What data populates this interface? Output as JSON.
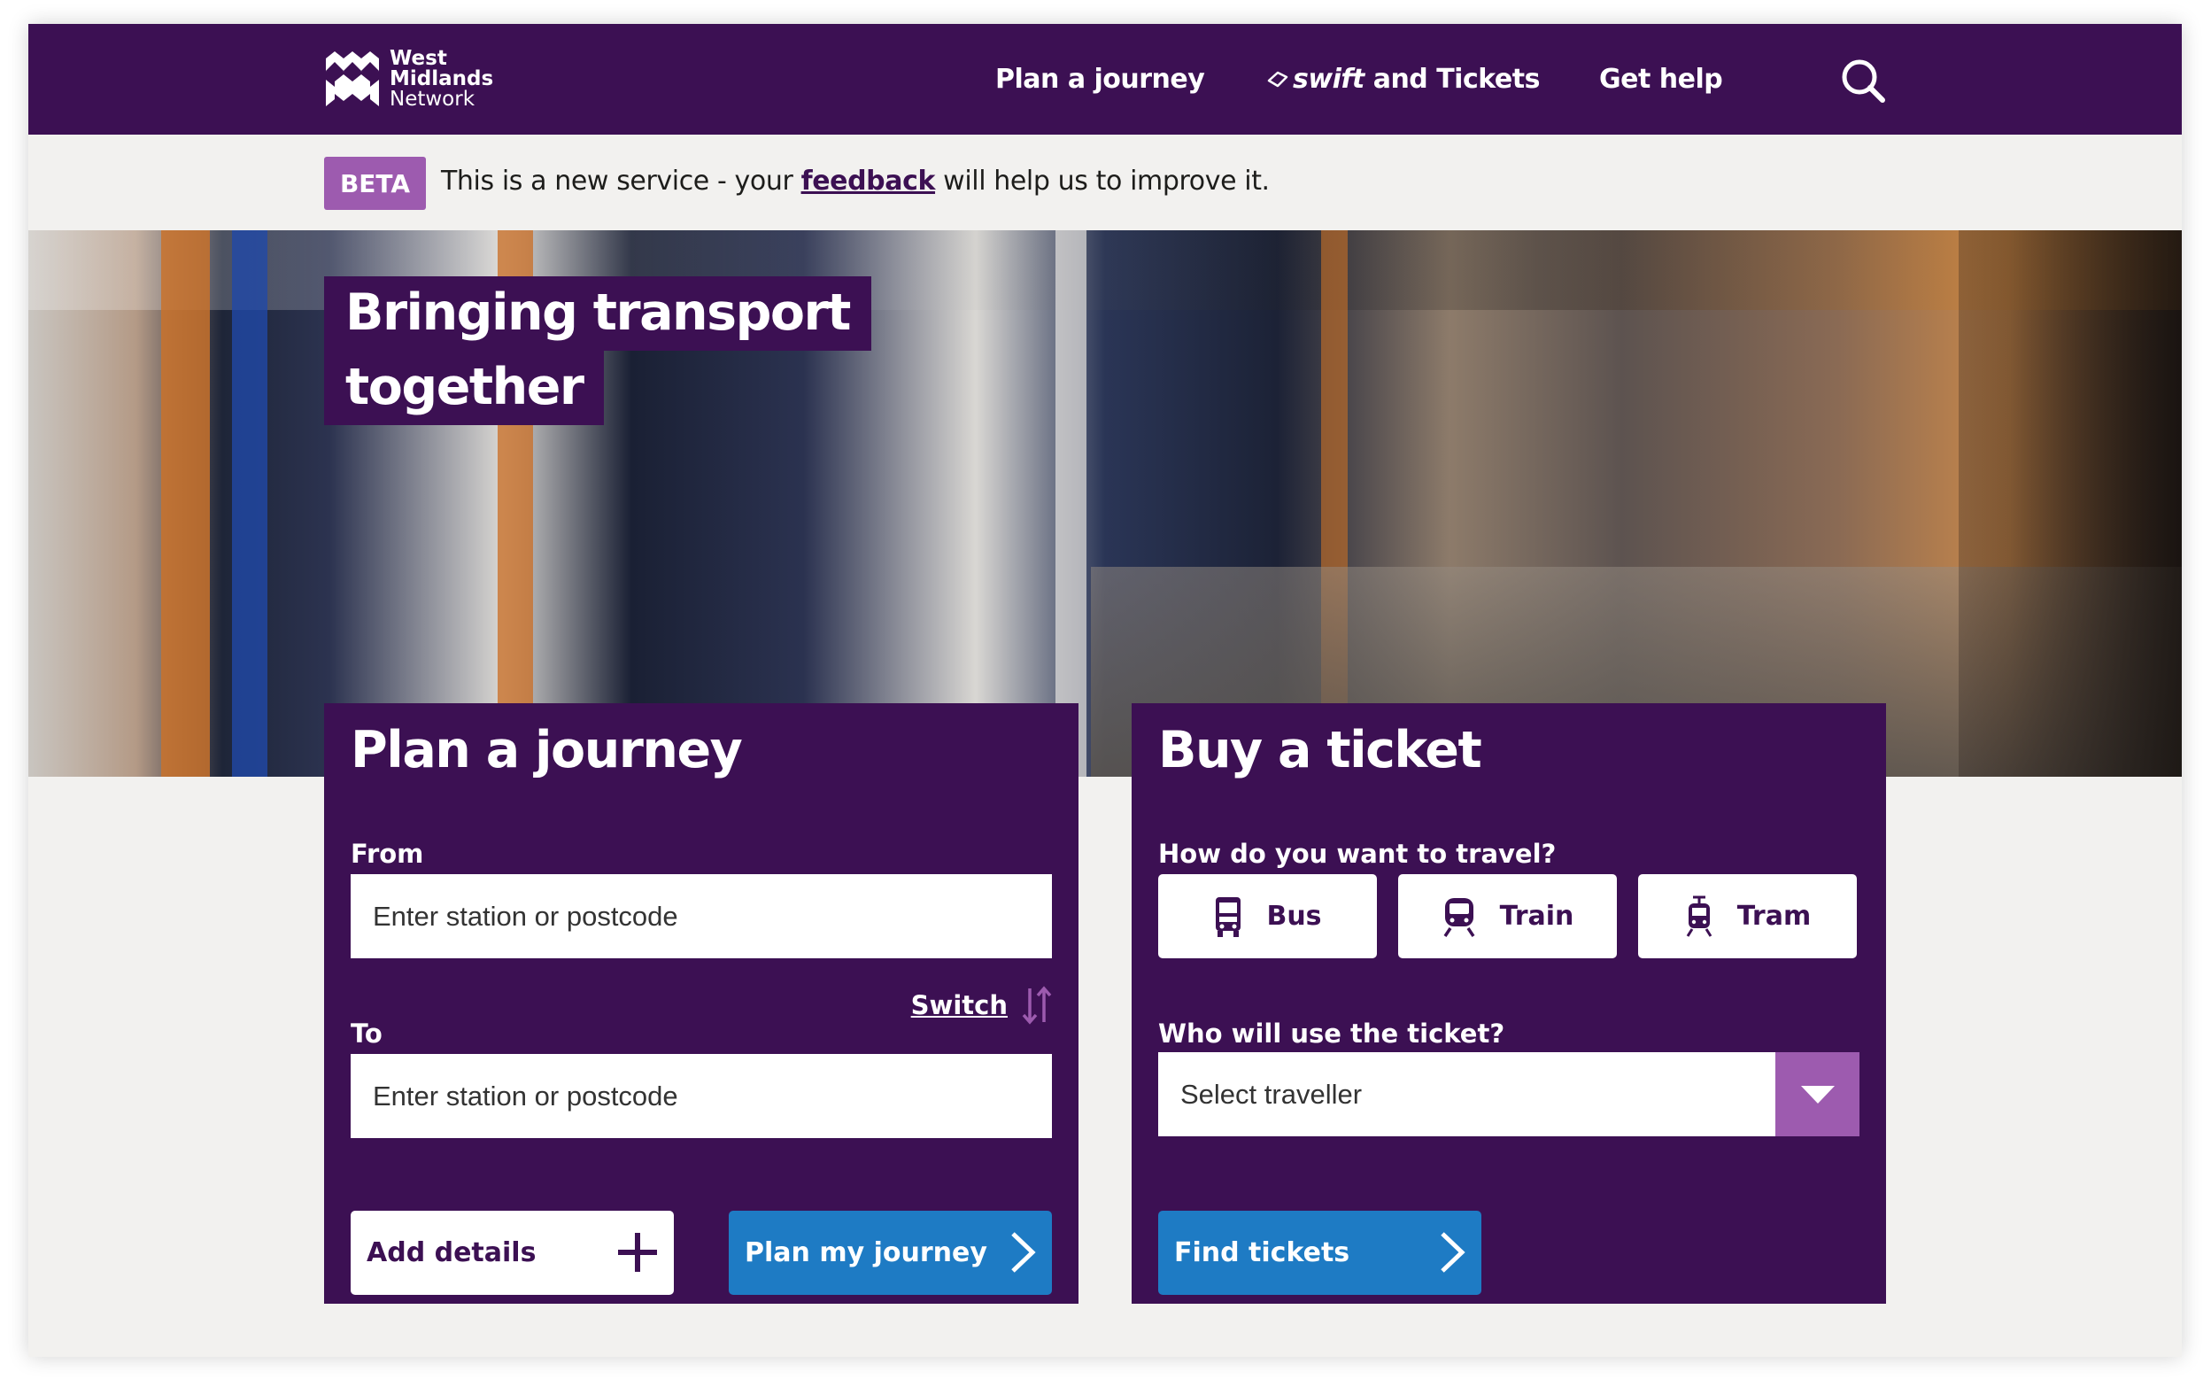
{
  "header": {
    "logo_line1": "West",
    "logo_line2": "Midlands",
    "logo_line3": "Network",
    "nav_plan": "Plan a journey",
    "nav_swift_brand": "swift",
    "nav_swift_rest": " and Tickets",
    "nav_help": "Get help",
    "search_icon": "search-icon"
  },
  "beta": {
    "tag": "BETA",
    "text_before": "This is a new service - your ",
    "link": "feedback",
    "text_after": " will help us to improve it."
  },
  "hero": {
    "title_line1": "Bringing transport",
    "title_line2": "together"
  },
  "plan": {
    "title": "Plan a journey",
    "from_label": "From",
    "from_placeholder": "Enter station or postcode",
    "to_label": "To",
    "to_placeholder": "Enter station or postcode",
    "switch_label": "Switch",
    "add_details": "Add details",
    "submit": "Plan my journey"
  },
  "buy": {
    "title": "Buy a ticket",
    "travel_question": "How do you want to travel?",
    "modes": [
      "Bus",
      "Train",
      "Tram"
    ],
    "traveller_question": "Who will use the ticket?",
    "traveller_selected": "Select traveller",
    "submit": "Find tickets"
  },
  "colors": {
    "brand_purple": "#3c1053",
    "accent_purple": "#9d5baf",
    "button_blue": "#1e7bc4",
    "page_bg": "#f2f1ef"
  }
}
